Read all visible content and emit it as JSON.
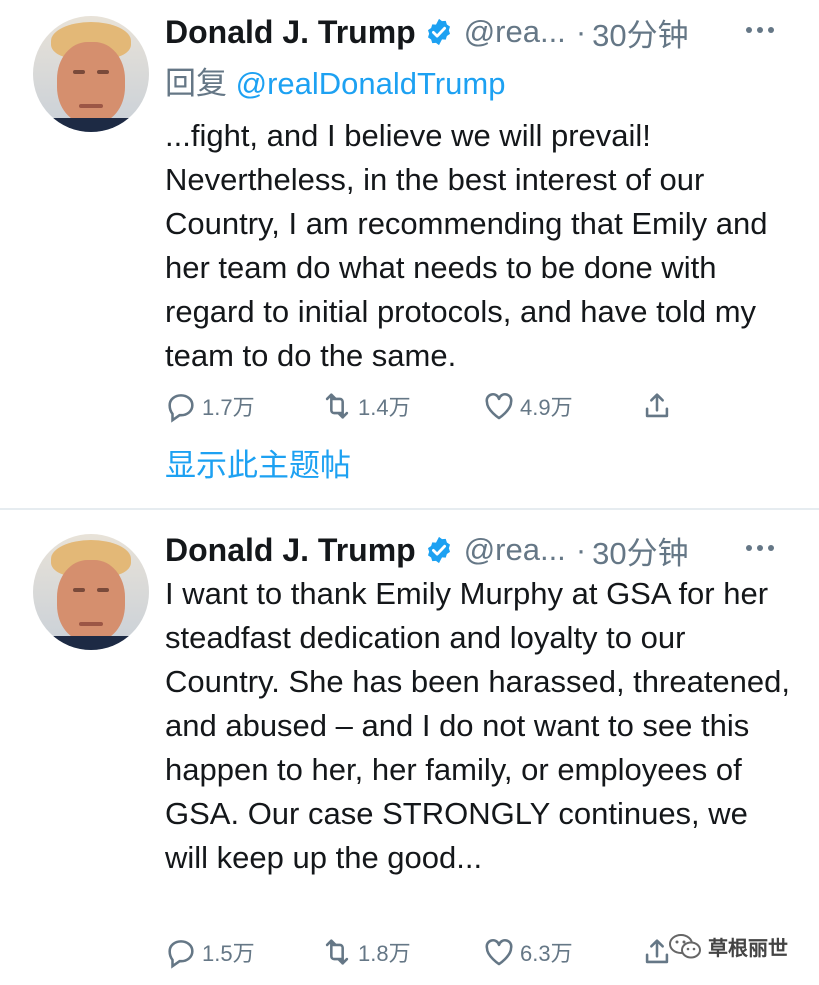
{
  "tweets": [
    {
      "name": "Donald J. Trump",
      "handle": "@rea...",
      "dot": "·",
      "time": "30分钟",
      "replying_prefix": "回复",
      "replying_to": "@realDonaldTrump",
      "text": "...fight, and I believe we will prevail! Nevertheless, in the best interest of our Country, I am recommending that Emily and her team do what needs to be done with regard to initial protocols, and have told my team to do the same.",
      "replies": "1.7万",
      "retweets": "1.4万",
      "likes": "4.9万",
      "show_thread": "显示此主题帖"
    },
    {
      "name": "Donald J. Trump",
      "handle": "@rea...",
      "dot": "·",
      "time": "30分钟",
      "text": "I want to thank Emily Murphy at GSA for her steadfast dedication and loyalty to our Country. She has been harassed, threatened, and abused – and I do not want to see this happen to her, her family, or employees of GSA. Our case STRONGLY continues, we will keep up the good...",
      "replies": "1.5万",
      "retweets": "1.8万",
      "likes": "6.3万"
    }
  ],
  "watermark": "草根丽世",
  "colors": {
    "accent": "#1da1f2",
    "muted": "#657786",
    "text": "#14171a",
    "divider": "#e6ecf0"
  },
  "icons": [
    "avatar",
    "verified-badge-icon",
    "more-icon",
    "reply-icon",
    "retweet-icon",
    "like-icon",
    "share-icon",
    "wechat-icon"
  ]
}
